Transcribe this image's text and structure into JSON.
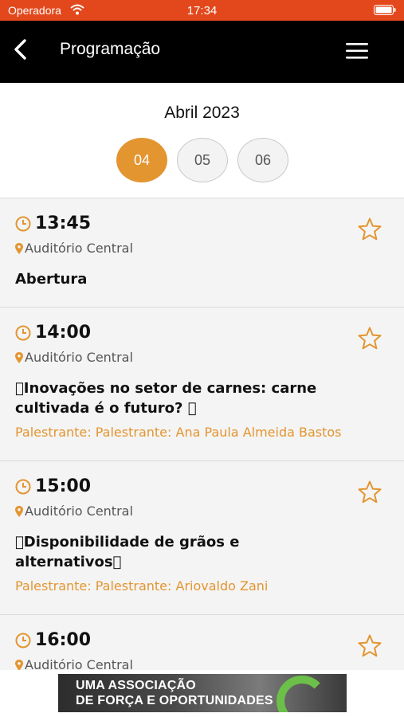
{
  "status_bar": {
    "carrier": "Operadora",
    "time": "17:34"
  },
  "nav": {
    "title": "Programação"
  },
  "calendar": {
    "month": "Abril 2023",
    "days": [
      {
        "label": "04",
        "selected": true
      },
      {
        "label": "05",
        "selected": false
      },
      {
        "label": "06",
        "selected": false
      }
    ]
  },
  "sessions": [
    {
      "time": "13:45",
      "location": "Auditório Central",
      "title": "Abertura",
      "speaker": ""
    },
    {
      "time": "14:00",
      "location": "Auditório Central",
      "title": "Inovações no setor de carnes: carne cultivada é o futuro? ",
      "speaker": "Palestrante: Palestrante: Ana Paula Almeida Bastos"
    },
    {
      "time": "15:00",
      "location": "Auditório Central",
      "title": "Disponibilidade de grãos e alternativos",
      "speaker": "Palestrante: Palestrante: Ariovaldo Zani"
    },
    {
      "time": "16:00",
      "location": "Auditório Central",
      "title": "",
      "speaker": ""
    }
  ],
  "banner": {
    "line1": "UMA ASSOCIAÇÃO",
    "line2": "DE FORÇA E OPORTUNIDADES"
  },
  "colors": {
    "status_bar": "#e2481c",
    "accent": "#e39530",
    "nav_bar": "#000000"
  },
  "icons": [
    "wifi-icon",
    "battery-icon",
    "back-icon",
    "menu-icon",
    "clock-icon",
    "pin-icon",
    "star-icon"
  ]
}
